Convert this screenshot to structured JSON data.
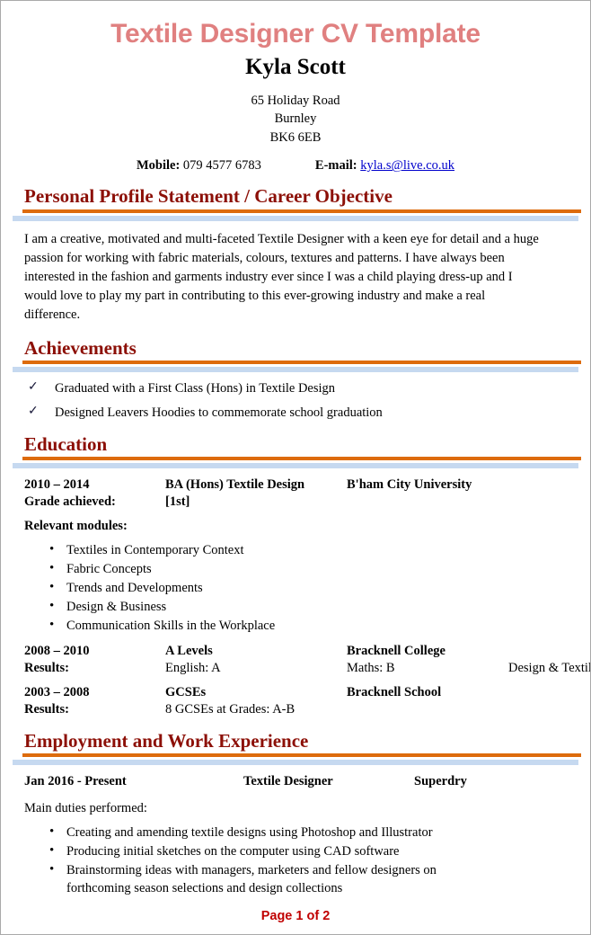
{
  "document": {
    "title": "Textile Designer CV Template",
    "name": "Kyla Scott"
  },
  "colors": {
    "title_pink": "#e08080",
    "heading_dark_red": "#8c0f06",
    "rule_orange": "#dd6b0c",
    "rule_blue": "#c6d9f0",
    "link_blue": "#0000cc",
    "footer_red": "#c00000"
  },
  "address": {
    "line1": "65 Holiday Road",
    "line2": "Burnley",
    "line3": "BK6 6EB"
  },
  "contact": {
    "mobile_label": "Mobile:",
    "mobile_value": "079 4577 6783",
    "email_label": "E-mail:",
    "email_value": "kyla.s@live.co.uk"
  },
  "sections": {
    "profile": {
      "heading": "Personal Profile Statement / Career Objective",
      "paragraph": "I am a creative, motivated and multi-faceted Textile Designer with a keen eye for detail and a huge passion for working with fabric materials, colours, textures and patterns. I have always been interested in the fashion and garments industry ever since I was a child playing dress-up and I would love to play my part in contributing to this ever-growing industry and make a real difference."
    },
    "achievements": {
      "heading": "Achievements",
      "items": [
        "Graduated with a First Class (Hons) in Textile Design",
        "Designed Leavers Hoodies to commemorate school graduation"
      ]
    },
    "education": {
      "heading": "Education",
      "degree": {
        "dates": "2010 – 2014",
        "qualification": "BA (Hons) Textile Design",
        "institution": "B'ham City University",
        "grade_label": "Grade achieved:",
        "grade_value": "[1st]",
        "modules_label": "Relevant modules:",
        "modules": [
          "Textiles in Contemporary Context",
          "Fabric Concepts",
          "Trends and Developments",
          "Design & Business",
          "Communication Skills in the Workplace"
        ]
      },
      "alevels": {
        "dates": "2008 – 2010",
        "qualification": "A Levels",
        "institution": "Bracknell College",
        "results_label": "Results:",
        "result1": "English: A",
        "result2": "Maths: B",
        "result3": "Design & Textiles: A"
      },
      "gcses": {
        "dates": "2003 – 2008",
        "qualification": "GCSEs",
        "institution": "Bracknell School",
        "results_label": "Results:",
        "result1": "8 GCSEs at Grades: A-B"
      }
    },
    "employment": {
      "heading": "Employment and Work Experience",
      "job": {
        "dates": "Jan 2016 - Present",
        "role": "Textile Designer",
        "company": "Superdry",
        "duties_label": "Main duties performed:",
        "duties": [
          "Creating and amending textile designs using Photoshop and Illustrator",
          "Producing initial sketches on the computer using CAD software",
          "Brainstorming ideas with managers, marketers and fellow designers on forthcoming season selections and design collections"
        ]
      }
    }
  },
  "footer": {
    "page_label": "Page 1 of 2"
  }
}
